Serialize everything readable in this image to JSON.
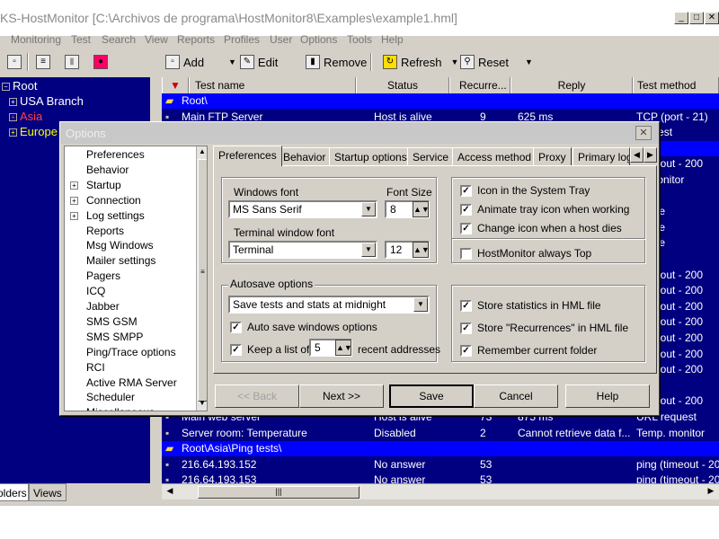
{
  "window": {
    "title": "KS-HostMonitor   [C:\\Archivos de programa\\HostMonitor8\\Examples\\example1.hml]",
    "btn_min": "_",
    "btn_max": "□",
    "btn_close": "✕"
  },
  "menu": [
    "Monitoring",
    "Test",
    "Search",
    "View",
    "Reports",
    "Profiles",
    "User",
    "Options",
    "Tools",
    "Help"
  ],
  "toolbar": {
    "add": "Add",
    "edit": "Edit",
    "remove": "Remove",
    "refresh": "Refresh",
    "reset": "Reset"
  },
  "tree": {
    "root": "Root",
    "items": [
      "USA Branch",
      "Asia",
      "Europe"
    ],
    "colors": {
      "asia": "#ff4040",
      "europe": "#ffff00"
    }
  },
  "left_tabs": [
    "olders",
    "Views"
  ],
  "grid": {
    "columns": [
      "Test name",
      "Status",
      "Recurre...",
      "Reply",
      "Test method"
    ],
    "rows": [
      {
        "type": "folder",
        "name": "Root\\"
      },
      {
        "type": "test",
        "name": "Main FTP Server",
        "status": "Host is alive",
        "rec": "9",
        "reply": "625 ms",
        "method": "TCP (port - 21)"
      },
      {
        "type": "test",
        "name": "",
        "status": "",
        "rec": "",
        "reply": "",
        "method": "request"
      },
      {
        "type": "folder",
        "name": ""
      },
      {
        "type": "test",
        "name": "",
        "status": "",
        "rec": "",
        "reply": "",
        "method": "(timeout - 200"
      },
      {
        "type": "test",
        "name": "",
        "status": "",
        "rec": "",
        "reply": "",
        "method": "p. monitor"
      },
      {
        "type": "test",
        "name": "",
        "status": "",
        "rec": "",
        "reply": "",
        "method": ""
      },
      {
        "type": "test",
        "name": "",
        "status": "",
        "rec": "",
        "reply": "",
        "method": "space"
      },
      {
        "type": "test",
        "name": "",
        "status": "",
        "rec": "",
        "reply": "",
        "method": "space"
      },
      {
        "type": "test",
        "name": "",
        "status": "",
        "rec": "",
        "reply": "",
        "method": "space"
      },
      {
        "type": "test",
        "name": "",
        "status": "",
        "rec": "",
        "reply": "",
        "method": ""
      },
      {
        "type": "test",
        "name": "",
        "status": "",
        "rec": "",
        "reply": "",
        "method": "(timeout - 200"
      },
      {
        "type": "test",
        "name": "",
        "status": "",
        "rec": "",
        "reply": "",
        "method": "(timeout - 200"
      },
      {
        "type": "test",
        "name": "",
        "status": "",
        "rec": "",
        "reply": "",
        "method": "(timeout - 200"
      },
      {
        "type": "test",
        "name": "",
        "status": "",
        "rec": "",
        "reply": "",
        "method": "(timeout - 200"
      },
      {
        "type": "test",
        "name": "",
        "status": "",
        "rec": "",
        "reply": "",
        "method": "(timeout - 200"
      },
      {
        "type": "test",
        "name": "",
        "status": "",
        "rec": "",
        "reply": "",
        "method": "(timeout - 200"
      },
      {
        "type": "test",
        "name": "",
        "status": "",
        "rec": "",
        "reply": "",
        "method": "(timeout - 200"
      },
      {
        "type": "test",
        "name": "",
        "status": "",
        "rec": "",
        "reply": "",
        "method": ""
      },
      {
        "type": "test",
        "name": "",
        "status": "",
        "rec": "",
        "reply": "",
        "method": "(timeout - 200"
      },
      {
        "type": "test",
        "name": "Main web server",
        "status": "Host is alive",
        "rec": "73",
        "reply": "875 ms",
        "method": "URL request"
      },
      {
        "type": "test",
        "name": "Server room: Temperature",
        "status": "Disabled",
        "rec": "2",
        "reply": "Cannot retrieve data f...",
        "method": "Temp. monitor"
      },
      {
        "type": "folder",
        "name": "Root\\Asia\\Ping tests\\"
      },
      {
        "type": "test",
        "name": "216.64.193.152",
        "status": "No answer",
        "rec": "53",
        "reply": "",
        "method": "ping (timeout - 200"
      },
      {
        "type": "test",
        "name": "216.64.193.153",
        "status": "No answer",
        "rec": "53",
        "reply": "",
        "method": "ping (timeout - 200"
      }
    ]
  },
  "dialog": {
    "title": "Options",
    "close": "✕",
    "categories": [
      {
        "label": "Preferences",
        "expandable": false
      },
      {
        "label": "Behavior",
        "expandable": false
      },
      {
        "label": "Startup",
        "expandable": true
      },
      {
        "label": "Connection",
        "expandable": true
      },
      {
        "label": "Log settings",
        "expandable": true
      },
      {
        "label": "Reports",
        "expandable": false
      },
      {
        "label": "Msg Windows",
        "expandable": false
      },
      {
        "label": "Mailer settings",
        "expandable": false
      },
      {
        "label": "Pagers",
        "expandable": false
      },
      {
        "label": "ICQ",
        "expandable": false
      },
      {
        "label": "Jabber",
        "expandable": false
      },
      {
        "label": "SMS GSM",
        "expandable": false
      },
      {
        "label": "SMS SMPP",
        "expandable": false
      },
      {
        "label": "Ping/Trace options",
        "expandable": false
      },
      {
        "label": "RCI",
        "expandable": false
      },
      {
        "label": "Active RMA Server",
        "expandable": false
      },
      {
        "label": "Scheduler",
        "expandable": false
      },
      {
        "label": "Miscellaneous",
        "expandable": false
      }
    ],
    "tabs": [
      "Preferences",
      "Behavior",
      "Startup options",
      "Service",
      "Access method",
      "Proxy",
      "Primary log"
    ],
    "active_tab": "Preferences",
    "fonts": {
      "windows_font_label": "Windows font",
      "windows_font": "MS Sans Serif",
      "font_size_label": "Font Size",
      "font_size": "8",
      "terminal_font_label": "Terminal window font",
      "terminal_font": "Terminal",
      "terminal_size": "12"
    },
    "tray": {
      "icon_in_tray": {
        "label": "Icon in the System Tray",
        "checked": true
      },
      "animate_tray": {
        "label": "Animate tray icon when working",
        "checked": true
      },
      "change_icon": {
        "label": "Change icon when a host dies",
        "checked": true
      },
      "always_top": {
        "label": "HostMonitor always Top",
        "checked": false
      }
    },
    "autosave": {
      "group_label": "Autosave options",
      "mode": "Save tests and stats at midnight",
      "auto_save_windows": {
        "label": "Auto save windows options",
        "checked": true
      },
      "keep_list": {
        "label": "Keep a list of",
        "checked": true
      },
      "keep_count": "5",
      "keep_suffix": "recent addresses"
    },
    "stats": {
      "store_stats": {
        "label": "Store statistics in HML file",
        "checked": true
      },
      "store_recurrences": {
        "label": "Store \"Recurrences\" in HML file",
        "checked": true
      },
      "remember_folder": {
        "label": "Remember current folder",
        "checked": true
      }
    },
    "buttons": {
      "back": "<<  Back",
      "next": "Next  >>",
      "save": "Save",
      "cancel": "Cancel",
      "help": "Help"
    }
  },
  "colors": {
    "tree_bg": "#000080",
    "folder_row": "#0000ff",
    "dialog_bg": "#d4d0c8"
  }
}
